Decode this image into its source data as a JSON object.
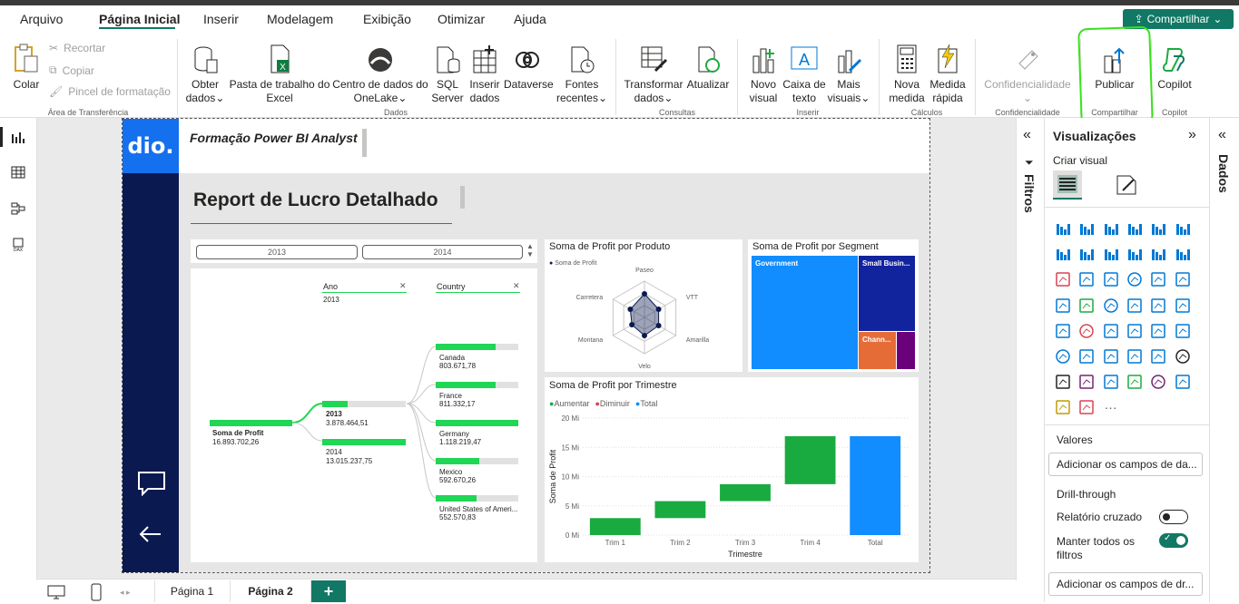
{
  "menu": {
    "items": [
      "Arquivo",
      "Página Inicial",
      "Inserir",
      "Modelagem",
      "Exibição",
      "Otimizar",
      "Ajuda"
    ],
    "share": "Compartilhar"
  },
  "ribbon": {
    "colar": "Colar",
    "recortar": "Recortar",
    "copiar": "Copiar",
    "pincel": "Pincel de formatação",
    "grp_clip": "Área de Transferência",
    "obter": "Obter",
    "dados": "dados",
    "pasta1": "Pasta de trabalho do",
    "pasta2": "Excel",
    "centro1": "Centro de dados do",
    "centro2": "OneLake",
    "sql1": "SQL",
    "sql2": "Server",
    "inserir1": "Inserir",
    "inserir2": "dados",
    "dataverse": "Dataverse",
    "fontes1": "Fontes",
    "fontes2": "recentes",
    "grp_dados": "Dados",
    "transf1": "Transformar",
    "transf2": "dados",
    "atualizar": "Atualizar",
    "grp_consultas": "Consultas",
    "novo1": "Novo",
    "novo2": "visual",
    "caixa1": "Caixa de",
    "caixa2": "texto",
    "mais1": "Mais",
    "mais2": "visuais",
    "grp_inserir": "Inserir",
    "nova1": "Nova",
    "nova2": "medida",
    "medida1": "Medida",
    "medida2": "rápida",
    "grp_calc": "Cálculos",
    "conf": "Confidencialidade",
    "grp_conf": "Confidencialidade",
    "publicar": "Publicar",
    "grp_comp": "Compartilhar",
    "copilot": "Copilot",
    "grp_copilot": "Copilot"
  },
  "report": {
    "logo": "dio.",
    "header_title": "Formação Power BI Analyst",
    "title": "Report de Lucro Detalhado",
    "slicer": [
      "2013",
      "2014"
    ],
    "decomp": {
      "ano_label": "Ano",
      "ano_value": "2013",
      "country_label": "Country",
      "root_label": "Soma de Profit",
      "root_value": "16.893.702,26",
      "years": [
        {
          "label": "2013",
          "value": "3.878.464,51",
          "fill": 0.3
        },
        {
          "label": "2014",
          "value": "13.015.237,75",
          "fill": 1.0
        }
      ],
      "countries": [
        {
          "label": "Canada",
          "value": "803.671,78",
          "fill": 0.72
        },
        {
          "label": "France",
          "value": "811.332,17",
          "fill": 0.73
        },
        {
          "label": "Germany",
          "value": "1.118.219,47",
          "fill": 1.0
        },
        {
          "label": "Mexico",
          "value": "592.670,26",
          "fill": 0.53
        },
        {
          "label": "United States of Ameri...",
          "value": "552.570,83",
          "fill": 0.49
        }
      ]
    },
    "radar": {
      "title": "Soma de Profit por Produto",
      "legend": "Soma de Profit",
      "labels": [
        "Paseo",
        "VTT",
        "Amarilla",
        "Velo",
        "Montana",
        "Carretera"
      ]
    },
    "treemap": {
      "title": "Soma de Profit por Segment",
      "cells": [
        "Government",
        "Small Busin...",
        "Chann..."
      ]
    },
    "waterfall": {
      "title": "Soma de Profit por Trimestre",
      "legend": [
        "Aumentar",
        "Diminuir",
        "Total"
      ],
      "ylabel": "Soma de Profit",
      "xlabel": "Trimestre"
    }
  },
  "chart_data": {
    "type": "bar",
    "title": "Soma de Profit por Trimestre",
    "xlabel": "Trimestre",
    "ylabel": "Soma de Profit",
    "categories": [
      "Trim 1",
      "Trim 2",
      "Trim 3",
      "Trim 4",
      "Total"
    ],
    "series": [
      {
        "name": "Aumentar",
        "values": [
          [
            0,
            2.9
          ],
          [
            2.9,
            5.8
          ],
          [
            5.8,
            8.7
          ],
          [
            8.7,
            16.9
          ],
          null
        ]
      },
      {
        "name": "Total",
        "values": [
          null,
          null,
          null,
          null,
          16.9
        ]
      }
    ],
    "yticks": [
      "0 Mi",
      "5 Mi",
      "10 Mi",
      "15 Mi",
      "20 Mi"
    ],
    "ylim": [
      0,
      20
    ],
    "colors": {
      "Aumentar": "#1aab40",
      "Diminuir": "#d64554",
      "Total": "#118dff"
    }
  },
  "panes": {
    "filtros": "Filtros",
    "viz": "Visualizações",
    "criar": "Criar visual",
    "dados": "Dados",
    "valores": "Valores",
    "add_fields": "Adicionar os campos de da...",
    "drill": "Drill-through",
    "cross": "Relatório cruzado",
    "keep": "Manter todos os filtros",
    "add_drill": "Adicionar os campos de dr..."
  },
  "pages": [
    "Página 1",
    "Página 2"
  ]
}
